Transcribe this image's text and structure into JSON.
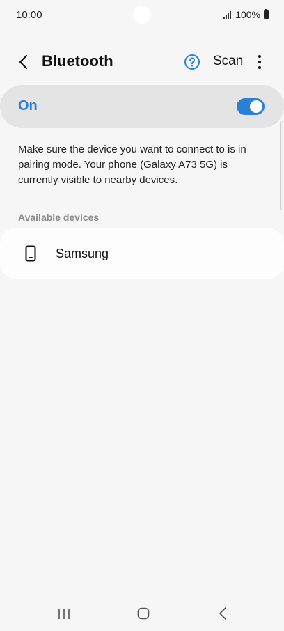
{
  "status_bar": {
    "time": "10:00",
    "battery": "100%",
    "icons": [
      "signal-icon",
      "battery-icon"
    ]
  },
  "header": {
    "title": "Bluetooth",
    "scan_label": "Scan",
    "icons": [
      "back-arrow-icon",
      "help-icon",
      "more-vertical-icon"
    ]
  },
  "toggle": {
    "label": "On",
    "state": true,
    "accent_color": "#2a7fd6"
  },
  "description": "Make sure the device you want to connect to is in pairing mode. Your phone (Galaxy A73 5G) is currently visible to nearby devices.",
  "available": {
    "header": "Available devices",
    "devices": [
      {
        "name": "Samsung",
        "icon": "phone-icon"
      }
    ]
  },
  "nav": {
    "icons": [
      "recents-icon",
      "home-icon",
      "back-icon"
    ]
  }
}
